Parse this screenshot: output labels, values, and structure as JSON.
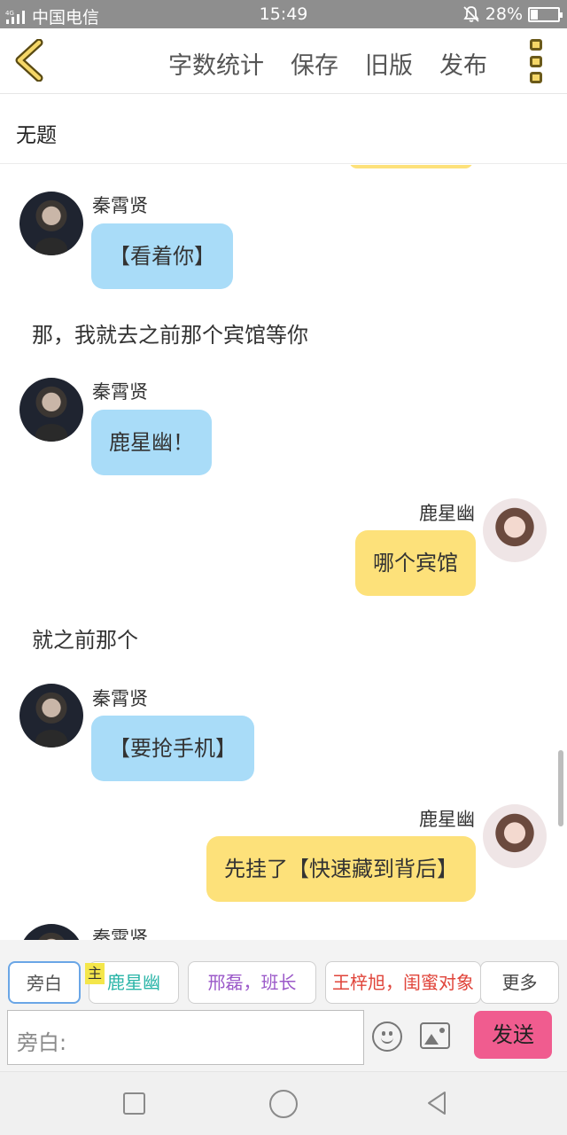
{
  "status_bar": {
    "network": "4G",
    "carrier": "中国电信",
    "time": "15:49",
    "battery": "28%",
    "battery_level": 0.28,
    "icons": [
      "signal-icon",
      "mute-bell-icon",
      "battery-icon"
    ]
  },
  "nav": {
    "back_icon": "chevron-left-icon",
    "actions": [
      "字数统计",
      "保存",
      "旧版",
      "发布"
    ],
    "more_icon": "more-vertical-icon",
    "accent": "#f5d768"
  },
  "doc": {
    "title": "无题"
  },
  "messages": [
    {
      "type": "char",
      "side": "left",
      "name": "秦霄贤",
      "text": "【看着你】",
      "bubble_color": "#a9dcf8"
    },
    {
      "type": "narration",
      "text": "那，我就去之前那个宾馆等你"
    },
    {
      "type": "char",
      "side": "left",
      "name": "秦霄贤",
      "text": "鹿星幽！",
      "bubble_color": "#a9dcf8"
    },
    {
      "type": "char",
      "side": "right",
      "name": "鹿星幽",
      "text": "哪个宾馆",
      "bubble_color": "#fde17a"
    },
    {
      "type": "narration",
      "text": "就之前那个"
    },
    {
      "type": "char",
      "side": "left",
      "name": "秦霄贤",
      "text": "【要抢手机】",
      "bubble_color": "#a9dcf8"
    },
    {
      "type": "char",
      "side": "right",
      "name": "鹿星幽",
      "text": "先挂了【快速藏到背后】",
      "bubble_color": "#fde17a"
    },
    {
      "type": "char",
      "side": "left",
      "name": "秦霄贤",
      "text": "",
      "bubble_color": "#a9dcf8"
    }
  ],
  "roles": {
    "main_tag": "主",
    "chips": [
      {
        "label": "旁白",
        "color": "#555555",
        "selected": true
      },
      {
        "label": "鹿星幽",
        "color": "#2bb5a8",
        "selected": false
      },
      {
        "label": "邢磊，班长",
        "color": "#9b59c9",
        "selected": false
      },
      {
        "label": "王梓旭，闺蜜对象",
        "color": "#e0443a",
        "selected": false
      }
    ],
    "more_label": "更多"
  },
  "composer": {
    "placeholder": "旁白:",
    "emoji_icon": "emoji-icon",
    "image_icon": "image-icon",
    "send_label": "发送",
    "send_color": "#f05c8f"
  },
  "system_nav": [
    "recent-apps-icon",
    "home-icon",
    "back-triangle-icon"
  ]
}
